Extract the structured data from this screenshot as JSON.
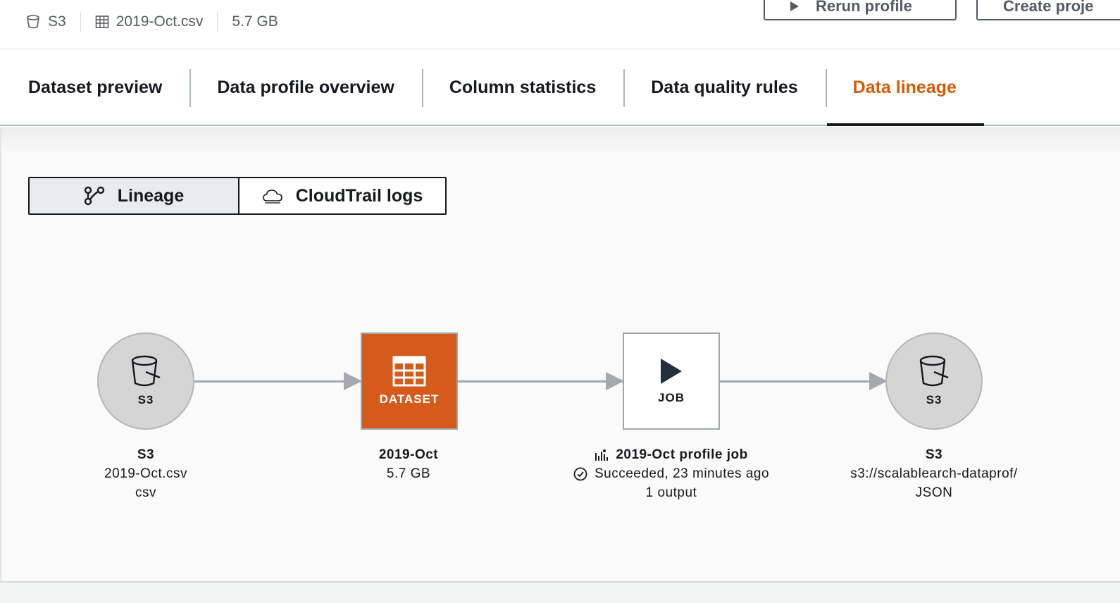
{
  "header": {
    "meta": [
      {
        "icon": "bucket-icon",
        "label": "S3"
      },
      {
        "icon": "table-icon",
        "label": "2019-Oct.csv"
      },
      {
        "icon": "",
        "label": "5.7 GB"
      }
    ],
    "buttons": {
      "rerun_label": "Rerun profile",
      "create_label": "Create proje"
    }
  },
  "tabs": [
    {
      "label": "Dataset preview",
      "active": false
    },
    {
      "label": "Data profile overview",
      "active": false
    },
    {
      "label": "Column statistics",
      "active": false
    },
    {
      "label": "Data quality rules",
      "active": false
    },
    {
      "label": "Data lineage",
      "active": true
    }
  ],
  "view_toggle": {
    "lineage_label": "Lineage",
    "cloudtrail_label": "CloudTrail logs",
    "selected": "Lineage"
  },
  "lineage": {
    "nodes": [
      {
        "kind": "S3",
        "tag": "S3",
        "icon": "bucket-icon",
        "title": "S3",
        "line1": "2019-Oct.csv",
        "line2": "csv"
      },
      {
        "kind": "DATASET",
        "tag": "DATASET",
        "icon": "table-grid-icon",
        "title": "2019-Oct",
        "line1": "5.7 GB"
      },
      {
        "kind": "JOB",
        "tag": "JOB",
        "icon": "play-icon",
        "title": "2019-Oct profile job",
        "line1": "Succeeded, 23 minutes ago",
        "line2": "1 output"
      },
      {
        "kind": "S3",
        "tag": "S3",
        "icon": "bucket-icon",
        "title": "S3",
        "line1": "s3://scalablearch-dataprof/",
        "line2": "JSON"
      }
    ]
  },
  "colors": {
    "accent_orange": "#d45b07",
    "dataset_node": "#d45b1b",
    "text": "#16191f",
    "muted": "#545b64"
  }
}
